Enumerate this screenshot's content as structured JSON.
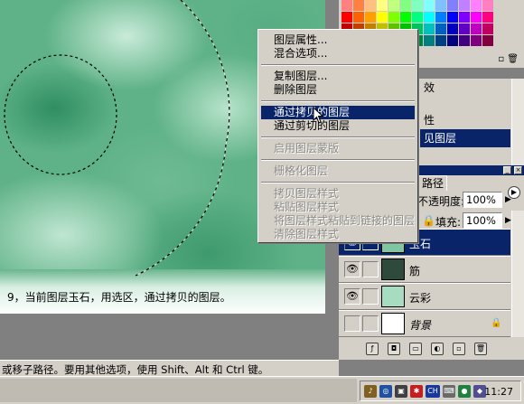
{
  "canvas": {
    "caption": "9，当前图层玉石，用选区，通过拷贝的图层。"
  },
  "status_bar": {
    "text": "或移子路径。要用其他选项，使用 Shift、Alt 和 Ctrl 键。"
  },
  "context_menu": {
    "items": [
      {
        "label": "图层属性...",
        "enabled": true
      },
      {
        "label": "混合选项...",
        "enabled": true
      },
      {
        "label": "复制图层...",
        "enabled": true
      },
      {
        "label": "删除图层",
        "enabled": true
      },
      {
        "label": "通过拷贝的图层",
        "enabled": true,
        "highlighted": true
      },
      {
        "label": "通过剪切的图层",
        "enabled": true
      },
      {
        "label": "启用图层蒙版",
        "enabled": false
      },
      {
        "label": "栅格化图层",
        "enabled": false
      },
      {
        "label": "拷贝图层样式",
        "enabled": false
      },
      {
        "label": "粘贴图层样式",
        "enabled": false
      },
      {
        "label": "将图层样式粘贴到链接的图层",
        "enabled": false
      },
      {
        "label": "清除图层样式",
        "enabled": false
      }
    ]
  },
  "history_panel": {
    "partial_rows": [
      "效",
      "性",
      "见图层"
    ],
    "selected_row_index": 2
  },
  "layers_panel": {
    "tab_label": "路径",
    "opacity_label": "不透明度:",
    "opacity_value": "100%",
    "fill_label": "填充:",
    "fill_value": "100%",
    "layers": [
      {
        "name": "玉石",
        "selected": true,
        "visible": true,
        "thumb": "#7fc7a0"
      },
      {
        "name": "筋",
        "selected": false,
        "visible": true,
        "thumb": "#2d4a3b"
      },
      {
        "name": "云彩",
        "selected": false,
        "visible": true,
        "thumb": "#a6dcc0"
      },
      {
        "name": "背景",
        "selected": false,
        "visible": false,
        "locked": true,
        "thumb": "#ffffff"
      }
    ]
  },
  "taskbar": {
    "clock": "11:27",
    "tray_icons": [
      "speaker-icon",
      "network-icon",
      "monitor-icon",
      "antivirus-icon",
      "ime-icon",
      "keyboard-icon",
      "tray-app-icon",
      "tray-app2-icon"
    ],
    "ime_label": "CH"
  },
  "colors": {
    "selection_blue": "#0a246a",
    "panel_gray": "#d4d0c8",
    "canvas_green": "#5fb287"
  }
}
